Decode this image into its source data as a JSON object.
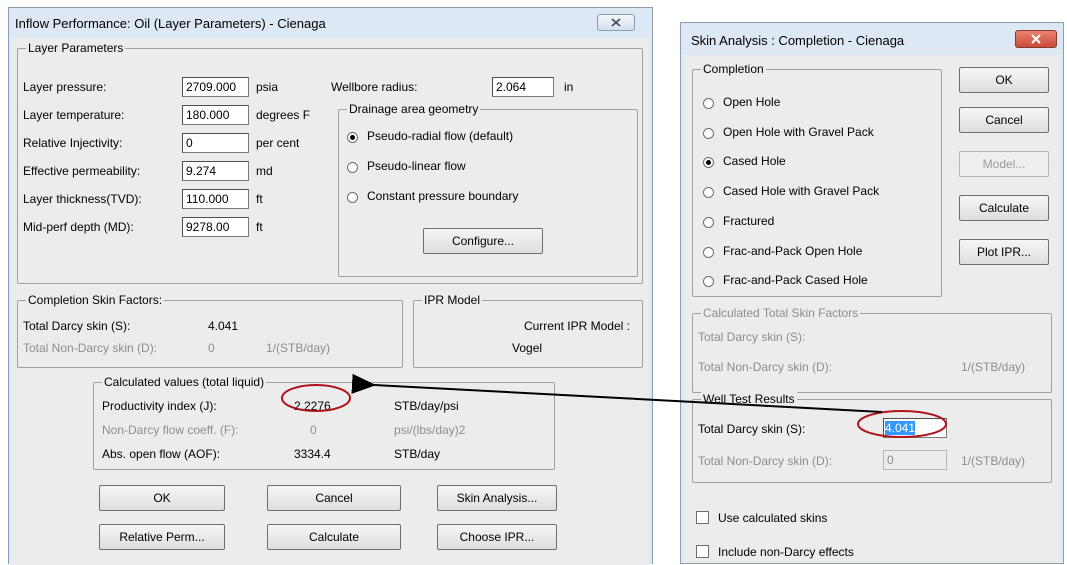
{
  "left_window": {
    "title": "Inflow Performance: Oil (Layer Parameters) - Cienaga",
    "layer": {
      "legend": "Layer Parameters",
      "pressure_label": "Layer pressure:",
      "pressure_value": "2709.000",
      "pressure_unit": "psia",
      "temperature_label": "Layer temperature:",
      "temperature_value": "180.000",
      "temperature_unit": "degrees F",
      "injectivity_label": "Relative Injectivity:",
      "injectivity_value": "0",
      "injectivity_unit": "per cent",
      "permeability_label": "Effective permeability:",
      "permeability_value": "9.274",
      "permeability_unit": "md",
      "thickness_label": "Layer thickness(TVD):",
      "thickness_value": "110.000",
      "thickness_unit": "ft",
      "midperf_label": "Mid-perf depth (MD):",
      "midperf_value": "9278.00",
      "midperf_unit": "ft",
      "wellbore_label": "Wellbore radius:",
      "wellbore_value": "2.064",
      "wellbore_unit": "in",
      "drainage_legend": "Drainage area geometry",
      "drainage_options": [
        "Pseudo-radial flow (default)",
        "Pseudo-linear flow",
        "Constant pressure boundary"
      ],
      "configure_label": "Configure..."
    },
    "skin": {
      "legend": "Completion Skin Factors:",
      "darcy_label": "Total Darcy skin (S):",
      "darcy_value": "4.041",
      "nondarcy_label": "Total Non-Darcy skin (D):",
      "nondarcy_value": "0",
      "nondarcy_unit": "1/(STB/day)"
    },
    "ipr": {
      "legend": "IPR Model",
      "current_label": "Current IPR Model :",
      "model": "Vogel"
    },
    "calc": {
      "legend": "Calculated values (total liquid)",
      "pi_label": "Productivity index (J):",
      "pi_value": "2.2276",
      "pi_unit": "STB/day/psi",
      "nondarcy_label": "Non-Darcy flow coeff. (F):",
      "nondarcy_value": "0",
      "nondarcy_unit": "psi/(lbs/day)2",
      "aof_label": "Abs. open flow (AOF):",
      "aof_value": "3334.4",
      "aof_unit": "STB/day"
    },
    "buttons": {
      "ok": "OK",
      "cancel": "Cancel",
      "skin_analysis": "Skin Analysis...",
      "relative_perm": "Relative Perm...",
      "calculate": "Calculate",
      "choose_ipr": "Choose IPR..."
    }
  },
  "right_window": {
    "title": "Skin Analysis : Completion - Cienaga",
    "completion": {
      "legend": "Completion",
      "options": [
        "Open Hole",
        "Open Hole with Gravel Pack",
        "Cased Hole",
        "Cased Hole with Gravel Pack",
        "Fractured",
        "Frac-and-Pack Open Hole",
        "Frac-and-Pack Cased Hole"
      ],
      "selected": "Cased Hole"
    },
    "buttons": {
      "ok": "OK",
      "cancel": "Cancel",
      "model": "Model...",
      "calculate": "Calculate",
      "plot_ipr": "Plot IPR..."
    },
    "calculated": {
      "legend": "Calculated Total Skin Factors",
      "darcy_label": "Total Darcy skin (S):",
      "nondarcy_label": "Total Non-Darcy skin (D):",
      "nondarcy_unit": "1/(STB/day)"
    },
    "well_test": {
      "legend": "Well Test Results",
      "darcy_label": "Total Darcy skin (S):",
      "darcy_value": "4.041",
      "nondarcy_label": "Total Non-Darcy skin (D):",
      "nondarcy_value": "0",
      "nondarcy_unit": "1/(STB/day)"
    },
    "use_calculated_label": "Use calculated skins",
    "include_nondarcy_label": "Include non-Darcy effects"
  },
  "colors": {
    "window_blue": "#dce8f4",
    "close_red": "#c94b3a",
    "annotation_red": "#b0121b",
    "selection_blue": "#3399ff"
  }
}
